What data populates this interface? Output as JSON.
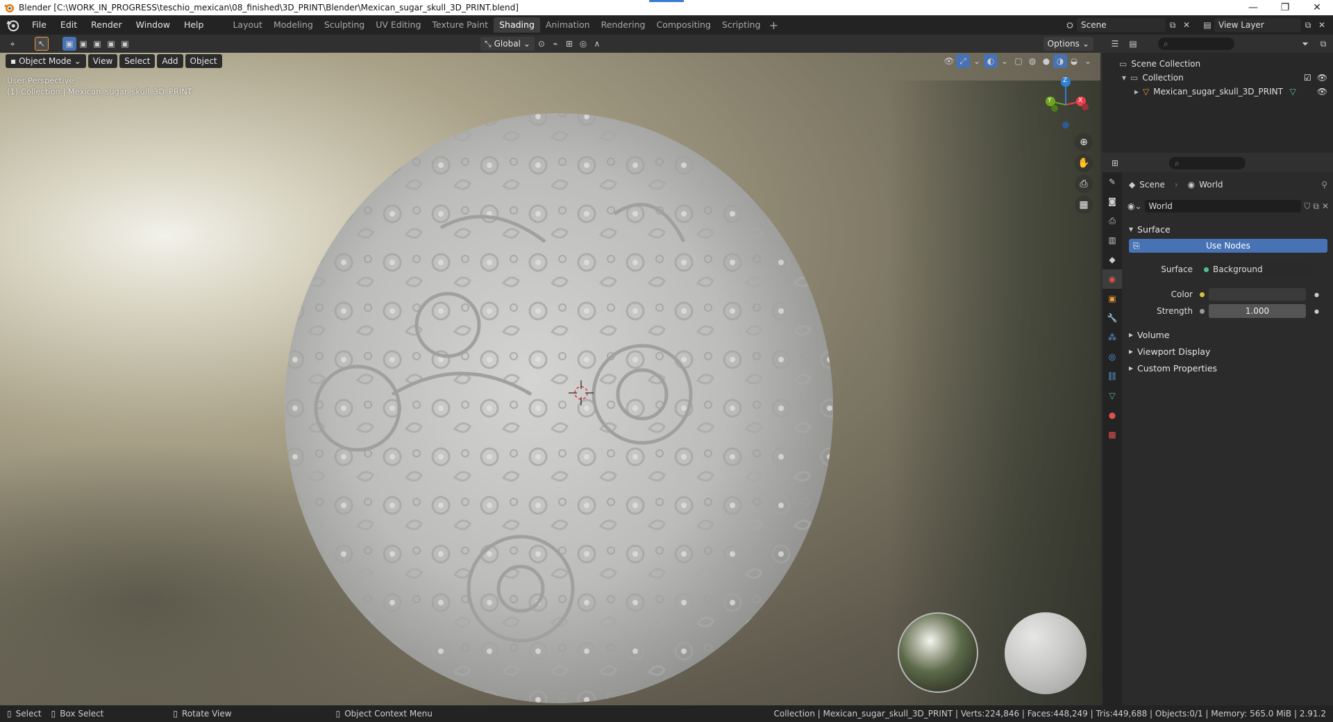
{
  "titlebar": {
    "title": "Blender [C:\\WORK_IN_PROGRESS\\teschio_mexican\\08_finished\\3D_PRINT\\Blender\\Mexican_sugar_skull_3D_PRINT.blend]",
    "minimize": "—",
    "maximize": "❐",
    "close": "✕"
  },
  "menu": {
    "items": [
      "File",
      "Edit",
      "Render",
      "Window",
      "Help"
    ]
  },
  "workspaces": {
    "tabs": [
      "Layout",
      "Modeling",
      "Sculpting",
      "UV Editing",
      "Texture Paint",
      "Shading",
      "Animation",
      "Rendering",
      "Compositing",
      "Scripting"
    ],
    "active": "Shading",
    "add": "+"
  },
  "topright": {
    "scene": "Scene",
    "view_layer": "View Layer"
  },
  "viewport_header": {
    "transform_orientation": "Global",
    "options": "Options"
  },
  "viewport_header2": {
    "mode": "Object Mode",
    "view": "View",
    "select": "Select",
    "add": "Add",
    "object": "Object"
  },
  "viewport": {
    "perspective": "User Perspective",
    "collection_info": "(1) Collection | Mexican_sugar_skull_3D_PRINT",
    "gizmo": {
      "z": "Z",
      "y": "Y",
      "x": "X"
    }
  },
  "outliner": {
    "scene_collection": "Scene Collection",
    "collection": "Collection",
    "object": "Mexican_sugar_skull_3D_PRINT"
  },
  "properties": {
    "breadcrumb_scene": "Scene",
    "breadcrumb_world": "World",
    "world_name": "World",
    "panels": {
      "surface": "Surface",
      "use_nodes": "Use Nodes",
      "surface_label": "Surface",
      "surface_value": "Background",
      "color_label": "Color",
      "strength_label": "Strength",
      "strength_value": "1.000",
      "volume": "Volume",
      "viewport_display": "Viewport Display",
      "custom_properties": "Custom Properties"
    }
  },
  "statusbar": {
    "select": "Select",
    "box_select": "Box Select",
    "rotate_view": "Rotate View",
    "context_menu": "Object Context Menu",
    "stats": "Collection | Mexican_sugar_skull_3D_PRINT | Verts:224,846 | Faces:448,249 | Tris:449,688 | Objects:0/1 | Memory: 565.0 MiB | 2.91.2"
  },
  "colors": {
    "accent_blue": "#4772b3",
    "active_tab": "#3d3d3d",
    "gizmo_x": "#e8414e",
    "gizmo_y": "#6ea51c",
    "gizmo_z": "#2e7fd6"
  }
}
